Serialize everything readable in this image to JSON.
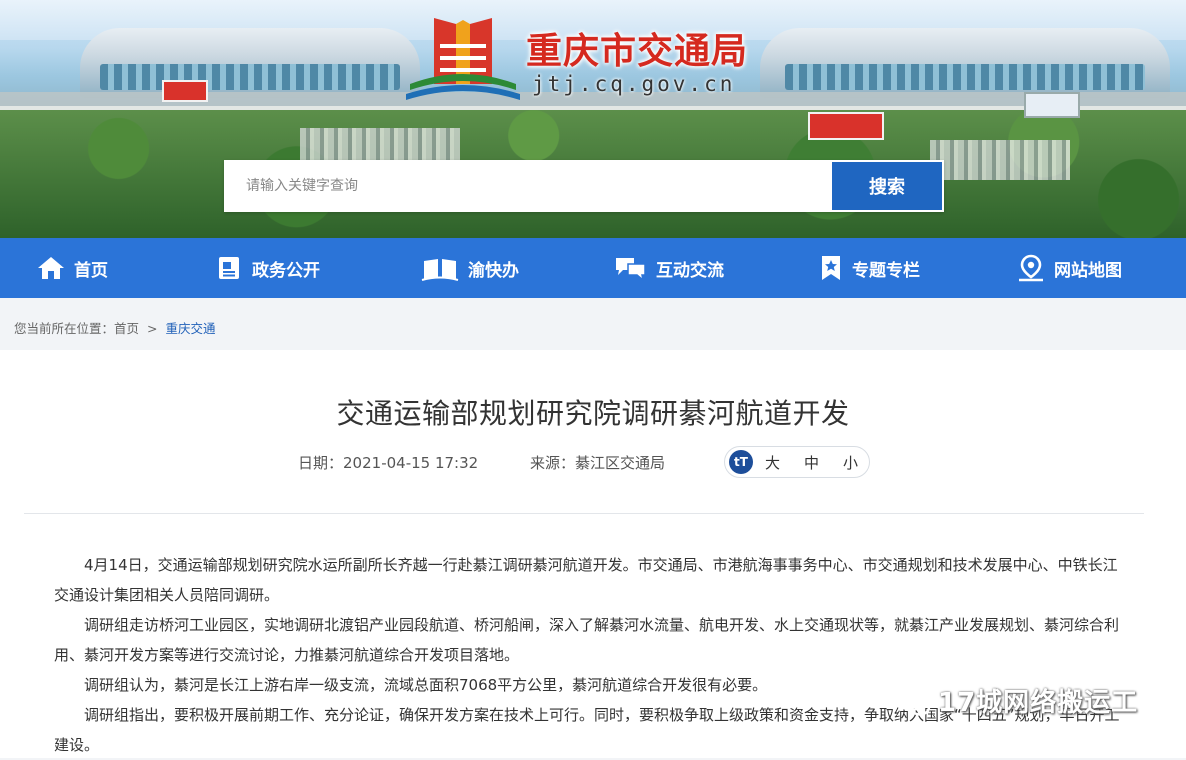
{
  "site": {
    "title": "重庆市交通局",
    "domain": "jtj.cq.gov.cn"
  },
  "search": {
    "placeholder": "请输入关键字查询",
    "button": "搜索"
  },
  "nav": {
    "items": [
      {
        "label": "首页",
        "icon": "home-icon"
      },
      {
        "label": "政务公开",
        "icon": "document-icon"
      },
      {
        "label": "渝快办",
        "icon": "book-icon"
      },
      {
        "label": "互动交流",
        "icon": "chat-icon"
      },
      {
        "label": "专题专栏",
        "icon": "bookmark-star-icon"
      },
      {
        "label": "网站地图",
        "icon": "map-pin-icon"
      }
    ]
  },
  "breadcrumb": {
    "prefix": "您当前所在位置：",
    "home": "首页",
    "separator": ">",
    "current": "重庆交通"
  },
  "article": {
    "title": "交通运输部规划研究院调研綦河航道开发",
    "date_label": "日期：",
    "date": "2021-04-15 17:32",
    "source_label": "来源：",
    "source": "綦江区交通局",
    "font_sizes": [
      "大",
      "中",
      "小"
    ],
    "paragraphs": [
      "4月14日，交通运输部规划研究院水运所副所长齐越一行赴綦江调研綦河航道开发。市交通局、市港航海事事务中心、市交通规划和技术发展中心、中铁长江交通设计集团相关人员陪同调研。",
      "调研组走访桥河工业园区，实地调研北渡铝产业园段航道、桥河船闸，深入了解綦河水流量、航电开发、水上交通现状等，就綦江产业发展规划、綦河综合利用、綦河开发方案等进行交流讨论，力推綦河航道综合开发项目落地。",
      "调研组认为，綦河是长江上游右岸一级支流，流域总面积7068平方公里，綦河航道综合开发很有必要。",
      "调研组指出，要积极开展前期工作、充分论证，确保开发方案在技术上可行。同时，要积极争取上级政策和资金支持，争取纳入国家“十四五”规划，早日开工建设。"
    ]
  },
  "watermark": "17城网络搬运工",
  "colors": {
    "nav": "#2b74d8",
    "search_button": "#1f66c1",
    "title_red": "#d5291f"
  }
}
